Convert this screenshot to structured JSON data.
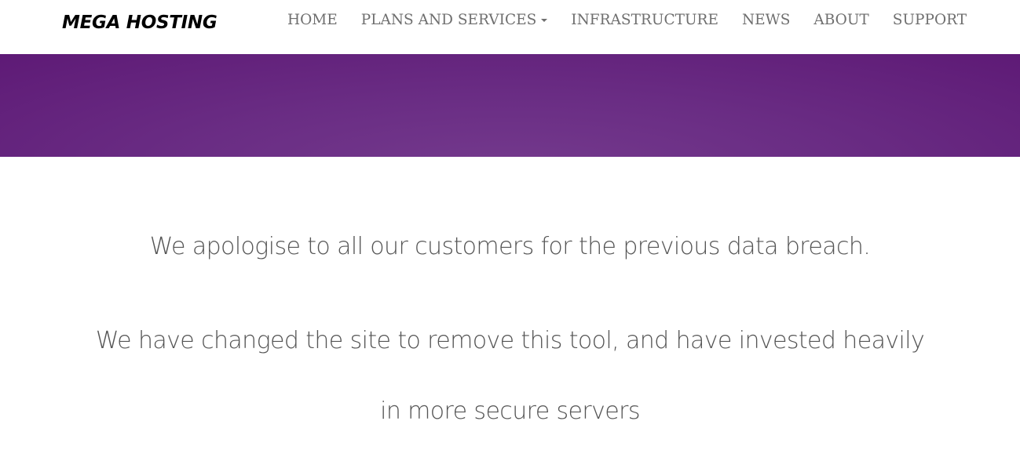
{
  "brand": {
    "name": "MEGA HOSTING"
  },
  "nav": {
    "items": [
      {
        "label": "HOME"
      },
      {
        "label": "PLANS AND SERVICES"
      },
      {
        "label": "INFRASTRUCTURE"
      },
      {
        "label": "NEWS"
      },
      {
        "label": "ABOUT"
      },
      {
        "label": "SUPPORT"
      }
    ]
  },
  "hero": {
    "color": "#5e1a76"
  },
  "content": {
    "line1": "We apologise to all our customers for the previous data breach.",
    "line2": "We have changed the site to remove this tool, and have invested heavily",
    "line3": "in more secure servers"
  }
}
